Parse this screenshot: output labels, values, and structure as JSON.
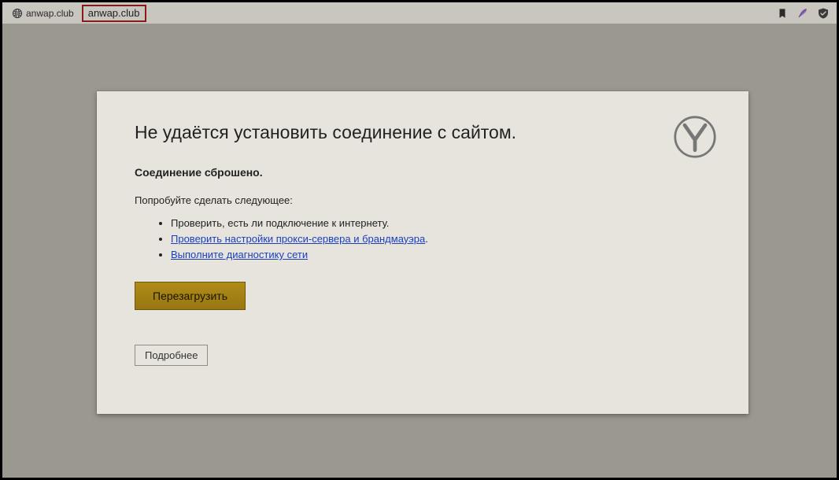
{
  "addressbar": {
    "tab_title": "anwap.club",
    "url": "anwap.club"
  },
  "error": {
    "heading": "Не удаётся установить соединение с сайтом.",
    "subheading": "Соединение сброшено.",
    "try_label": "Попробуйте сделать следующее:",
    "items": [
      {
        "text": "Проверить, есть ли подключение к интернету.",
        "link": false
      },
      {
        "text": "Проверить настройки прокси-сервера и брандмауэра",
        "link": true,
        "trailing": "."
      },
      {
        "text": "Выполните диагностику сети",
        "link": true,
        "trailing": ""
      }
    ],
    "reload_label": "Перезагрузить",
    "details_label": "Подробнее"
  }
}
